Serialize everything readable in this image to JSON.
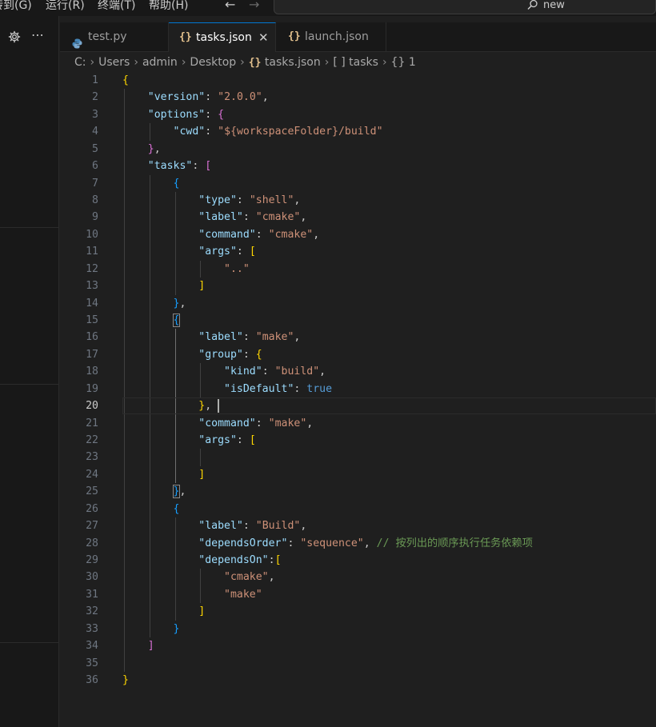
{
  "menubar": {
    "items": [
      {
        "label": "转到(G)"
      },
      {
        "label": "运行(R)"
      },
      {
        "label": "终端(T)"
      },
      {
        "label": "帮助(H)"
      }
    ],
    "back_arrow": "←",
    "forward_arrow": "→",
    "search_text": "new",
    "search_icon": "search-icon"
  },
  "sidebar": {
    "gear_icon": "gear-icon",
    "more_icon": "ellipsis-icon"
  },
  "tabs": [
    {
      "label": "test.py",
      "icon": "python-icon",
      "active": false
    },
    {
      "label": "tasks.json",
      "icon": "json-braces-icon",
      "active": true,
      "close": "✕"
    },
    {
      "label": "launch.json",
      "icon": "json-braces-icon",
      "active": false
    }
  ],
  "json_icon_text": "{}",
  "breadcrumb": {
    "parts": [
      "C:",
      "Users",
      "admin",
      "Desktop"
    ],
    "file": "tasks.json",
    "array_icon": "[ ]",
    "array_label": "tasks",
    "object_icon": "{}",
    "object_label": "1"
  },
  "editor": {
    "current_line": 20,
    "lines": [
      {
        "n": "1"
      },
      {
        "n": "2"
      },
      {
        "n": "3"
      },
      {
        "n": "4"
      },
      {
        "n": "5"
      },
      {
        "n": "6"
      },
      {
        "n": "7"
      },
      {
        "n": "8"
      },
      {
        "n": "9"
      },
      {
        "n": "10"
      },
      {
        "n": "11"
      },
      {
        "n": "12"
      },
      {
        "n": "13"
      },
      {
        "n": "14"
      },
      {
        "n": "15"
      },
      {
        "n": "16"
      },
      {
        "n": "17"
      },
      {
        "n": "18"
      },
      {
        "n": "19"
      },
      {
        "n": "20"
      },
      {
        "n": "21"
      },
      {
        "n": "22"
      },
      {
        "n": "23"
      },
      {
        "n": "24"
      },
      {
        "n": "25"
      },
      {
        "n": "26"
      },
      {
        "n": "27"
      },
      {
        "n": "28"
      },
      {
        "n": "29"
      },
      {
        "n": "30"
      },
      {
        "n": "31"
      },
      {
        "n": "32"
      },
      {
        "n": "33"
      },
      {
        "n": "34"
      },
      {
        "n": "35"
      },
      {
        "n": "36"
      }
    ],
    "code": [
      [
        {
          "t": "{",
          "c": "b1"
        }
      ],
      [
        {
          "t": "    "
        },
        {
          "t": "\"version\"",
          "c": "tok-key"
        },
        {
          "t": ": "
        },
        {
          "t": "\"2.0.0\"",
          "c": "tok-str"
        },
        {
          "t": ","
        }
      ],
      [
        {
          "t": "    "
        },
        {
          "t": "\"options\"",
          "c": "tok-key"
        },
        {
          "t": ": "
        },
        {
          "t": "{",
          "c": "b2"
        }
      ],
      [
        {
          "t": "        "
        },
        {
          "t": "\"cwd\"",
          "c": "tok-key"
        },
        {
          "t": ": "
        },
        {
          "t": "\"${workspaceFolder}/build\"",
          "c": "tok-str"
        }
      ],
      [
        {
          "t": "    "
        },
        {
          "t": "}",
          "c": "b2"
        },
        {
          "t": ","
        }
      ],
      [
        {
          "t": "    "
        },
        {
          "t": "\"tasks\"",
          "c": "tok-key"
        },
        {
          "t": ": "
        },
        {
          "t": "[",
          "c": "b2"
        }
      ],
      [
        {
          "t": "        "
        },
        {
          "t": "{",
          "c": "b3"
        }
      ],
      [
        {
          "t": "            "
        },
        {
          "t": "\"type\"",
          "c": "tok-key"
        },
        {
          "t": ": "
        },
        {
          "t": "\"shell\"",
          "c": "tok-str"
        },
        {
          "t": ","
        }
      ],
      [
        {
          "t": "            "
        },
        {
          "t": "\"label\"",
          "c": "tok-key"
        },
        {
          "t": ": "
        },
        {
          "t": "\"cmake\"",
          "c": "tok-str"
        },
        {
          "t": ","
        }
      ],
      [
        {
          "t": "            "
        },
        {
          "t": "\"command\"",
          "c": "tok-key"
        },
        {
          "t": ": "
        },
        {
          "t": "\"cmake\"",
          "c": "tok-str"
        },
        {
          "t": ","
        }
      ],
      [
        {
          "t": "            "
        },
        {
          "t": "\"args\"",
          "c": "tok-key"
        },
        {
          "t": ": "
        },
        {
          "t": "[",
          "c": "b1"
        }
      ],
      [
        {
          "t": "                "
        },
        {
          "t": "\"..\"",
          "c": "tok-str"
        }
      ],
      [
        {
          "t": "            "
        },
        {
          "t": "]",
          "c": "b1"
        }
      ],
      [
        {
          "t": "        "
        },
        {
          "t": "}",
          "c": "b3"
        },
        {
          "t": ","
        }
      ],
      [
        {
          "t": "        "
        },
        {
          "t": "{",
          "c": "b3 bmatch"
        }
      ],
      [
        {
          "t": "            "
        },
        {
          "t": "\"label\"",
          "c": "tok-key"
        },
        {
          "t": ": "
        },
        {
          "t": "\"make\"",
          "c": "tok-str"
        },
        {
          "t": ","
        }
      ],
      [
        {
          "t": "            "
        },
        {
          "t": "\"group\"",
          "c": "tok-key"
        },
        {
          "t": ": "
        },
        {
          "t": "{",
          "c": "b1"
        }
      ],
      [
        {
          "t": "                "
        },
        {
          "t": "\"kind\"",
          "c": "tok-key"
        },
        {
          "t": ": "
        },
        {
          "t": "\"build\"",
          "c": "tok-str"
        },
        {
          "t": ","
        }
      ],
      [
        {
          "t": "                "
        },
        {
          "t": "\"isDefault\"",
          "c": "tok-key"
        },
        {
          "t": ": "
        },
        {
          "t": "true",
          "c": "tok-kw"
        }
      ],
      [
        {
          "t": "            "
        },
        {
          "t": "}",
          "c": "b1"
        },
        {
          "t": ","
        }
      ],
      [
        {
          "t": "            "
        },
        {
          "t": "\"command\"",
          "c": "tok-key"
        },
        {
          "t": ": "
        },
        {
          "t": "\"make\"",
          "c": "tok-str"
        },
        {
          "t": ","
        }
      ],
      [
        {
          "t": "            "
        },
        {
          "t": "\"args\"",
          "c": "tok-key"
        },
        {
          "t": ": "
        },
        {
          "t": "[",
          "c": "b1"
        }
      ],
      [
        {
          "t": ""
        }
      ],
      [
        {
          "t": "            "
        },
        {
          "t": "]",
          "c": "b1"
        }
      ],
      [
        {
          "t": "        "
        },
        {
          "t": "}",
          "c": "b3 bmatch"
        },
        {
          "t": ","
        }
      ],
      [
        {
          "t": "        "
        },
        {
          "t": "{",
          "c": "b3"
        }
      ],
      [
        {
          "t": "            "
        },
        {
          "t": "\"label\"",
          "c": "tok-key"
        },
        {
          "t": ": "
        },
        {
          "t": "\"Build\"",
          "c": "tok-str"
        },
        {
          "t": ","
        }
      ],
      [
        {
          "t": "            "
        },
        {
          "t": "\"dependsOrder\"",
          "c": "tok-key"
        },
        {
          "t": ": "
        },
        {
          "t": "\"sequence\"",
          "c": "tok-str"
        },
        {
          "t": ", "
        },
        {
          "t": "// 按列出的顺序执行任务依赖项",
          "c": "tok-com"
        }
      ],
      [
        {
          "t": "            "
        },
        {
          "t": "\"dependsOn\"",
          "c": "tok-key"
        },
        {
          "t": ":"
        },
        {
          "t": "[",
          "c": "b1"
        }
      ],
      [
        {
          "t": "                "
        },
        {
          "t": "\"cmake\"",
          "c": "tok-str"
        },
        {
          "t": ","
        }
      ],
      [
        {
          "t": "                "
        },
        {
          "t": "\"make\"",
          "c": "tok-str"
        }
      ],
      [
        {
          "t": "            "
        },
        {
          "t": "]",
          "c": "b1"
        }
      ],
      [
        {
          "t": "        "
        },
        {
          "t": "}",
          "c": "b3"
        }
      ],
      [
        {
          "t": "    "
        },
        {
          "t": "]",
          "c": "b2"
        }
      ],
      [
        {
          "t": ""
        }
      ],
      [
        {
          "t": "}",
          "c": "b1"
        }
      ]
    ]
  }
}
